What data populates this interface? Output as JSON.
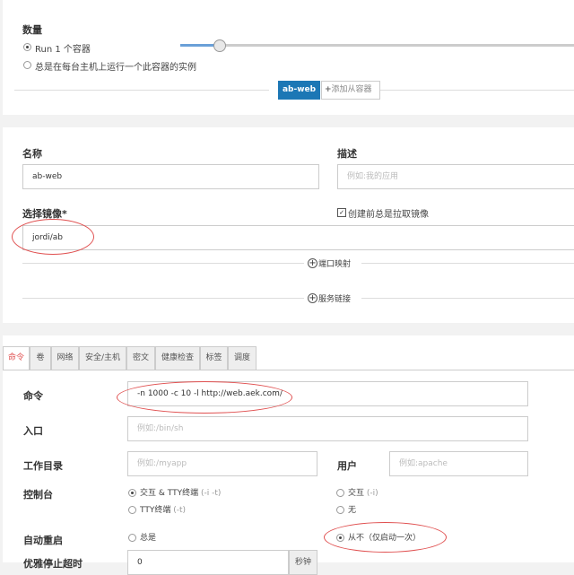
{
  "quantity": {
    "heading": "数量",
    "run_option": "Run 1 个容器",
    "always_option": "总是在每台主机上运行一个此容器的实例",
    "slider_value": 0.1
  },
  "containers": {
    "active_tab": "ab-web",
    "add_button": "添加从容器"
  },
  "form": {
    "name_label": "名称",
    "name_value": "ab-web",
    "desc_label": "描述",
    "desc_placeholder": "例如:我的应用",
    "image_label": "选择镜像*",
    "image_value": "jordi/ab",
    "pull_label": "创建前总是拉取镜像",
    "port_mapping": "端口映射",
    "service_link": "服务链接"
  },
  "tabs": [
    "命令",
    "卷",
    "网络",
    "安全/主机",
    "密文",
    "健康检查",
    "标签",
    "调度"
  ],
  "command": {
    "cmd_label": "命令",
    "cmd_value": "-n 1000 -c 10 -l http://web.aek.com/",
    "entry_label": "入口",
    "entry_placeholder": "例如:/bin/sh",
    "workdir_label": "工作目录",
    "workdir_placeholder": "例如:/myapp",
    "user_label": "用户",
    "user_placeholder": "例如:apache",
    "console_label": "控制台",
    "console_opt1": "交互 & TTY终端",
    "console_opt1_hint": "(-i -t)",
    "console_opt2": "TTY终端",
    "console_opt2_hint": "(-t)",
    "console_opt3": "交互",
    "console_opt3_hint": "(-i)",
    "console_opt4": "无",
    "restart_label": "自动重启",
    "restart_opt1": "总是",
    "restart_opt2": "从不（仅启动一次）",
    "timeout_label": "优雅停止超时",
    "timeout_value": "0",
    "timeout_unit": "秒钟"
  }
}
